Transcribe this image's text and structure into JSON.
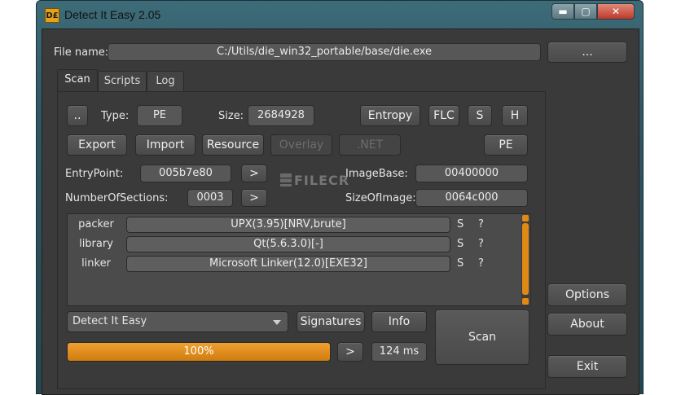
{
  "window": {
    "title": "Detect It Easy 2.05",
    "icon": "die-app-icon",
    "icon_text": "D£",
    "controls": {
      "minimize": "▬",
      "maximize": "▢",
      "close": "✕"
    }
  },
  "file": {
    "label": "File name:",
    "value": "C:/Utils/die_win32_portable/base/die.exe",
    "browse_label": "..."
  },
  "tabs": [
    {
      "label": "Scan",
      "active": true
    },
    {
      "label": "Scripts",
      "active": false
    },
    {
      "label": "Log",
      "active": false
    }
  ],
  "scan": {
    "dots_label": "..",
    "type_label": "Type:",
    "type_value": "PE",
    "size_label": "Size:",
    "size_value": "2684928",
    "entropy_label": "Entropy",
    "flc_label": "FLC",
    "s_label": "S",
    "h_label": "H",
    "export_label": "Export",
    "import_label": "Import",
    "resource_label": "Resource",
    "overlay_label": "Overlay",
    "net_label": ".NET",
    "pe_label": "PE",
    "entrypoint_label": "EntryPoint:",
    "entrypoint_value": "005b7e80",
    "entrypoint_go": ">",
    "imagebase_label": "ImageBase:",
    "imagebase_value": "00400000",
    "numsections_label": "NumberOfSections:",
    "numsections_value": "0003",
    "numsections_go": ">",
    "sizeofimage_label": "SizeOfImage:",
    "sizeofimage_value": "0064c000"
  },
  "results": [
    {
      "type": "packer",
      "value": "UPX(3.95)[NRV,brute]",
      "s": "S",
      "q": "?"
    },
    {
      "type": "library",
      "value": "Qt(5.6.3.0)[-]",
      "s": "S",
      "q": "?"
    },
    {
      "type": "linker",
      "value": "Microsoft Linker(12.0)[EXE32]",
      "s": "S",
      "q": "?"
    }
  ],
  "bottom": {
    "engine_selected": "Detect It Easy",
    "signatures_label": "Signatures",
    "info_label": "Info",
    "scan_label": "Scan",
    "progress_percent": 100,
    "progress_text": "100%",
    "go_label": ">",
    "time_value": "124 ms"
  },
  "side": {
    "options_label": "Options",
    "about_label": "About",
    "exit_label": "Exit"
  },
  "watermark": {
    "text": "FILECR"
  },
  "colors": {
    "accent": "#e08a16",
    "window_bg": "#3a3a3a",
    "frame": "#2f5662"
  }
}
